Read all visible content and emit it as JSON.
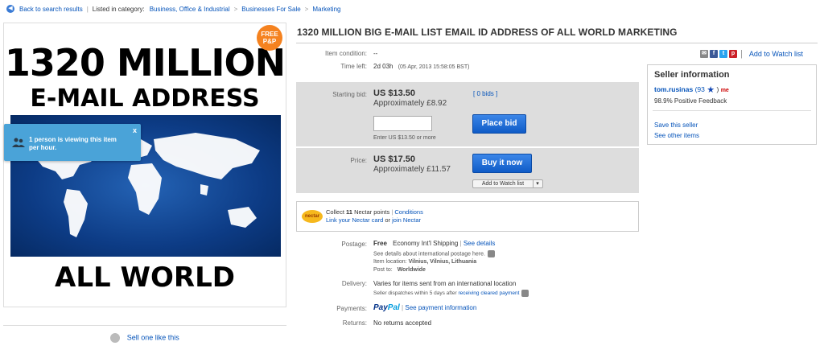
{
  "breadcrumb": {
    "back": "Back to search results",
    "listed_in": "Listed in category:",
    "cat1": "Business, Office & Industrial",
    "cat2": "Businesses For Sale",
    "cat3": "Marketing",
    "sep": ">"
  },
  "image": {
    "line1": "1320 MILLION",
    "line2": "E-MAIL ADDRESS",
    "line3": "ALL WORLD",
    "badge1": "FREE",
    "badge2": "P&P"
  },
  "viewers_popup": {
    "text": "1 person is viewing this item per hour.",
    "close": "x"
  },
  "sell_one": "Sell one like this",
  "title": "1320 MILLION BIG E-MAIL LIST EMAIL ID ADDRESS OF ALL WORLD MARKETING",
  "item": {
    "condition_label": "Item condition:",
    "condition_value": "--",
    "time_label": "Time left:",
    "time_value": "2d 03h",
    "time_detail": "(05 Apr, 2013   15:58:05 BST)"
  },
  "share": {
    "add_watch": "Add to Watch list",
    "sep": "|"
  },
  "bid": {
    "label": "Starting bid:",
    "price": "US $13.50",
    "approx": "Approximately £8.92",
    "bids_link": "[ 0 bids ]",
    "input_value": "",
    "hint": "Enter US $13.50 or more",
    "button": "Place bid"
  },
  "buy": {
    "label": "Price:",
    "price": "US $17.50",
    "approx": "Approximately £11.57",
    "button": "Buy it now",
    "watch_button": "Add to Watch list"
  },
  "nectar": {
    "logo": "nectar",
    "collect_pre": "Collect",
    "points": "11",
    "collect_post": "Nectar points",
    "sep": "|",
    "conditions": "Conditions",
    "link_card": "Link your Nectar card",
    "or": "or",
    "join": "join Nectar"
  },
  "postage": {
    "label": "Postage:",
    "free": "Free",
    "method": "Economy Int'l Shipping",
    "sep": "|",
    "see_details": "See details",
    "intl_note": "See details about international postage here.",
    "location_label": "Item location:",
    "location": "Vilnius, Vilnius, Lithuania",
    "post_to_label": "Post to:",
    "post_to": "Worldwide"
  },
  "delivery": {
    "label": "Delivery:",
    "value": "Varies for items sent from an international location",
    "note_pre": "Seller dispatches within 5 days after",
    "note_link": "receiving cleared payment"
  },
  "payments": {
    "label": "Payments:",
    "paypal1": "Pay",
    "paypal2": "Pal",
    "sep": "|",
    "link": "See payment information"
  },
  "returns": {
    "label": "Returns:",
    "value": "No returns accepted"
  },
  "seller": {
    "heading": "Seller information",
    "name": "tom.rusinas",
    "score": "(93",
    "close_paren": ")",
    "feedback": "98.9% Positive Feedback",
    "save": "Save this seller",
    "other": "See other items"
  },
  "colors": {
    "accent": "#0654ba",
    "button": "#1a6ad8",
    "badge": "#f5821f",
    "popup": "#4aa3d8"
  }
}
